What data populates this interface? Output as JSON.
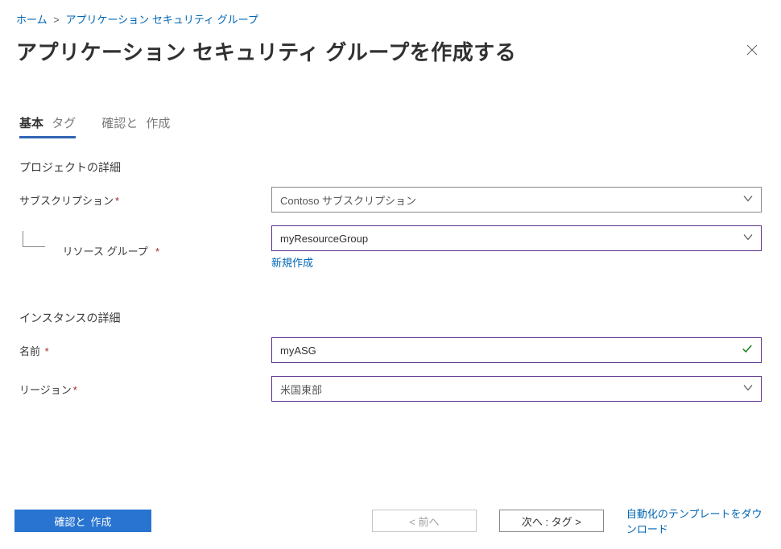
{
  "breadcrumb": {
    "home": "ホーム",
    "sep": ">",
    "current": "アプリケーション セキュリティ グループ"
  },
  "title": "アプリケーション セキュリティ グループを作成する",
  "tabs": {
    "basic": "基本",
    "tags": "タグ",
    "review_confirm": "確認と",
    "review_create": "作成"
  },
  "sections": {
    "project": "プロジェクトの詳細",
    "instance": "インスタンスの詳細"
  },
  "fields": {
    "subscription": {
      "label": "サブスクリプション",
      "value": "Contoso サブスクリプション"
    },
    "resource_group": {
      "label": "リソース グループ",
      "value": "myResourceGroup",
      "create_new": "新規作成"
    },
    "name": {
      "label": "名前",
      "value": "myASG"
    },
    "region": {
      "label": "リージョン",
      "value": "米国東部"
    }
  },
  "footer": {
    "review_confirm": "確認と",
    "review_create": "作成",
    "prev": "< 前へ",
    "next": "次へ : タグ >",
    "download": "自動化のテンプレートをダウンロード"
  }
}
